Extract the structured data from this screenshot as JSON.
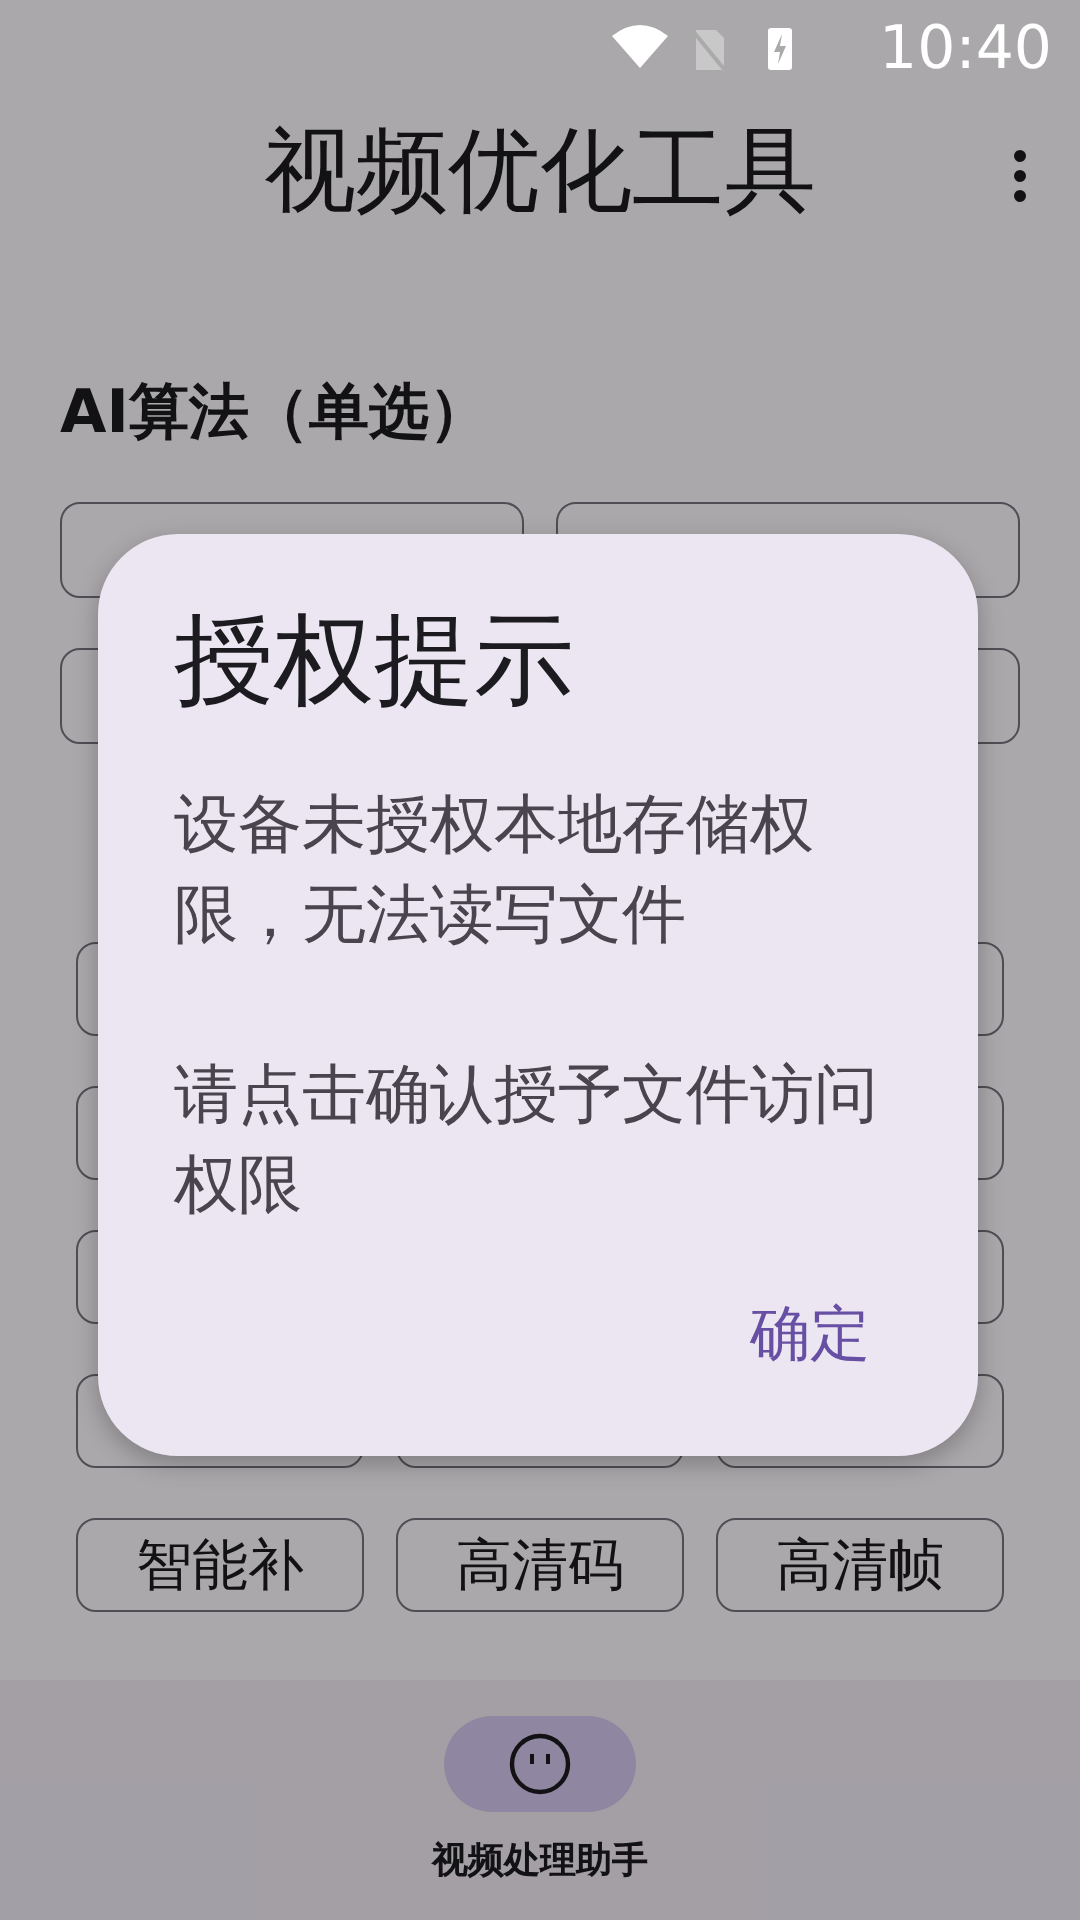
{
  "status_bar": {
    "time": "10:40"
  },
  "app_bar": {
    "title": "视频优化工具"
  },
  "ai_section": {
    "title": "AI算法（单选）",
    "chips": [
      {
        "kind": "covered"
      },
      {
        "kind": "covered"
      },
      {
        "kind": "covered"
      },
      {
        "kind": "covered"
      }
    ]
  },
  "feature_section": {
    "rows": [
      {
        "chips": [
          {
            "kind": "covered"
          },
          {
            "kind": "covered"
          }
        ]
      },
      {
        "chips": [
          {
            "kind": "covered"
          },
          {
            "kind": "covered"
          }
        ]
      },
      {
        "chips": [
          {
            "kind": "covered"
          },
          {
            "kind": "covered"
          }
        ]
      },
      {
        "chips": [
          {
            "kind": "covered"
          },
          {
            "kind": "covered"
          },
          {
            "kind": "covered"
          }
        ]
      },
      {
        "chips": [
          {
            "kind": "label",
            "label": "智能补"
          },
          {
            "kind": "label",
            "label": "高清码"
          },
          {
            "kind": "label",
            "label": "高清帧"
          }
        ]
      }
    ]
  },
  "bottom_nav": {
    "items": [
      {
        "label": "视频处理助手",
        "selected": true
      }
    ]
  },
  "dialog": {
    "title": "授权提示",
    "paragraphs": [
      "设备未授权本地存储权限，无法读写文件",
      "请点击确认授予文件访问权限"
    ],
    "button": "确定"
  }
}
